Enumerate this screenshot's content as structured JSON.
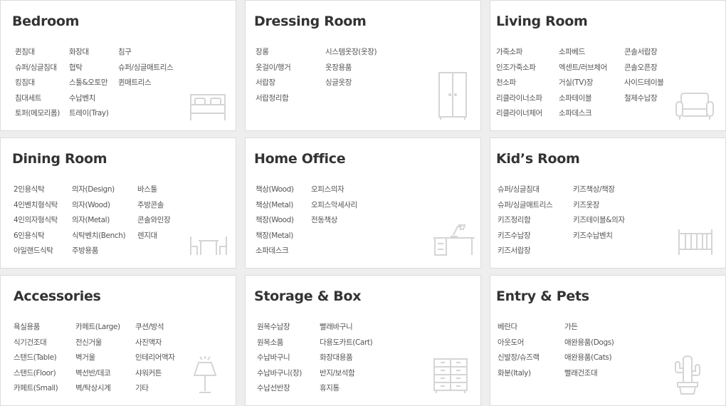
{
  "categories": [
    {
      "title": "Bedroom",
      "columns": [
        [
          "퀸침대",
          "슈퍼/싱글침대",
          "킹침대",
          "침대세트",
          "토퍼(메모리폼)"
        ],
        [
          "화장대",
          "협탁",
          "스툴&오토만",
          "수납벤치",
          "트레이(Tray)"
        ],
        [
          "침구",
          "슈퍼/싱글매트리스",
          "퀸매트리스"
        ]
      ],
      "icon": "bed-icon"
    },
    {
      "title": "Dressing Room",
      "columns": [
        [
          "장롱",
          "옷걸이/행거",
          "서랍장",
          "서랍정리함"
        ],
        [
          "시스템옷장(옷장)",
          "옷장용품",
          "싱글옷장"
        ]
      ],
      "icon": "wardrobe-icon"
    },
    {
      "title": "Living Room",
      "columns": [
        [
          "가죽소파",
          "인조가죽소파",
          "천소파",
          "리클라이너소파",
          "리클라이너체어"
        ],
        [
          "소파베드",
          "엑센트/러브체어",
          "거실(TV)장",
          "소파테이블",
          "소파데스크"
        ],
        [
          "콘솔서랍장",
          "콘솔오픈장",
          "사이드테이블",
          "철제수납장"
        ]
      ],
      "icon": "sofa-icon"
    },
    {
      "title": "Dining Room",
      "columns": [
        [
          "2인용식탁",
          "4인벤치형식탁",
          "4인의자형식탁",
          "6인용식탁",
          "아일랜드식탁"
        ],
        [
          "의자(Design)",
          "의자(Wood)",
          "의자(Metal)",
          "식탁벤치(Bench)",
          "주방용품"
        ],
        [
          "바스툴",
          "주방콘솔",
          "콘솔와인장",
          "렌지대"
        ]
      ],
      "icon": "dining-table-icon"
    },
    {
      "title": "Home Office",
      "columns": [
        [
          "책상(Wood)",
          "책상(Metal)",
          "책장(Wood)",
          "책장(Metal)",
          "소파데스크"
        ],
        [
          "오피스의자",
          "오피스악세사리",
          "전동책상"
        ]
      ],
      "icon": "desk-icon"
    },
    {
      "title": "Kid’s Room",
      "columns": [
        [
          "슈퍼/싱글침대",
          "슈퍼/싱글매트리스",
          "키즈정리함",
          "키즈수납장",
          "키즈서랍장"
        ],
        [
          "키즈책상/책장",
          "키즈옷장",
          "키즈테이블&의자",
          "키즈수납벤치"
        ]
      ],
      "icon": "crib-icon"
    },
    {
      "title": "Accessories",
      "columns": [
        [
          "욕실용품",
          "식기건조대",
          "스탠드(Table)",
          "스탠드(Floor)",
          "카페트(Small)"
        ],
        [
          "카페트(Large)",
          "전신거울",
          "벽거울",
          "벽선반/데코",
          "벽/탁상시계"
        ],
        [
          "쿠션/방석",
          "사진액자",
          "인테리어액자",
          "샤워커튼",
          "기타"
        ]
      ],
      "icon": "lamp-icon"
    },
    {
      "title": "Storage & Box",
      "columns": [
        [
          "원목수납장",
          "원목소품",
          "수납바구니",
          "수납바구니(장)",
          "수납선반장"
        ],
        [
          "빨래바구니",
          "다용도카트(Cart)",
          "화장대용품",
          "반지/보석함",
          "휴지통"
        ]
      ],
      "icon": "drawer-chest-icon"
    },
    {
      "title": "Entry & Pets",
      "columns": [
        [
          "베란다",
          "아웃도어",
          "신발장/슈즈랙",
          "화분(Italy)"
        ],
        [
          "가든",
          "애완용품(Dogs)",
          "애완용품(Cats)",
          "빨래건조대"
        ]
      ],
      "icon": "cactus-icon"
    }
  ]
}
